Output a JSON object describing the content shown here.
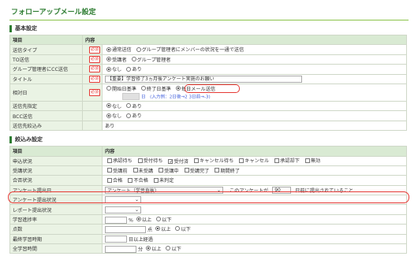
{
  "page_title": "フォローアップメール設定",
  "required_badge": "必須",
  "basic": {
    "section_title": "基本設定",
    "col_item": "項目",
    "col_content": "内容",
    "send_type": {
      "label": "送信タイプ",
      "options": [
        "通常送信",
        "グループ管理者にメンバーの状況を一通で送信"
      ]
    },
    "to": {
      "label": "TO送信",
      "options": [
        "受講者",
        "グループ管理者"
      ]
    },
    "group_cc": {
      "label": "グループ管理者にCC送信",
      "options": [
        "なし",
        "あり"
      ]
    },
    "title": {
      "label": "タイトル",
      "value": "【重要】学習修了3ヵ月後アンケート実施のお願い"
    },
    "relative_day": {
      "label": "相対日",
      "options": [
        "開始日基準",
        "終了日基準",
        "毎日メール送信"
      ],
      "hint": "日　(入力例：2日後→2  3日前→-3)"
    },
    "send_target": {
      "label": "送信先指定",
      "options": [
        "なし",
        "あり"
      ]
    },
    "bcc": {
      "label": "BCC送信",
      "options": [
        "なし",
        "あり"
      ]
    },
    "narrowed": {
      "label": "送信先絞込み",
      "value": "あり"
    }
  },
  "filter": {
    "section_title": "絞込み設定",
    "col_item": "項目",
    "col_content": "内容",
    "application": {
      "label": "申込状況",
      "options": [
        "承認待ち",
        "受付待ち",
        "受付済",
        "キャンセル待ち",
        "キャンセル",
        "承認却下",
        "無効"
      ],
      "checked": [
        false,
        false,
        true,
        false,
        false,
        false,
        false
      ]
    },
    "course": {
      "label": "受講状況",
      "options": [
        "受講前",
        "未受講",
        "受講中",
        "受講完了",
        "期間終了"
      ]
    },
    "pass": {
      "label": "合否状況",
      "options": [
        "合格",
        "不合格",
        "未判定"
      ]
    },
    "survey": {
      "label": "アンケート提出日",
      "select_value": "アンケート（学習直後）",
      "text_before": "このアンケートが",
      "days": "90",
      "text_after": "日前に提出されていること"
    },
    "survey_status": {
      "label": "アンケート提出状況"
    },
    "report_status": {
      "label": "レポート提出状況"
    },
    "progress": {
      "label": "学習進捗率",
      "unit": "%",
      "options": [
        "以上",
        "以下"
      ]
    },
    "score": {
      "label": "点数",
      "unit": "点",
      "options": [
        "以上",
        "以下"
      ]
    },
    "last_study": {
      "label": "最終学習時期",
      "suffix": "日以上経過"
    },
    "total_time": {
      "label": "全学習時間",
      "unit": "分",
      "options": [
        "以上",
        "以下"
      ]
    }
  }
}
